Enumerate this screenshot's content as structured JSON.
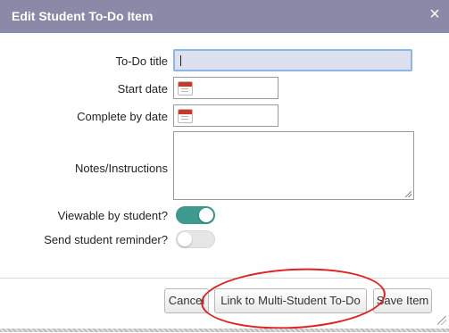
{
  "dialog": {
    "title": "Edit Student To-Do Item",
    "close_label": "×"
  },
  "form": {
    "todo_title": {
      "label": "To-Do title",
      "value": ""
    },
    "start_date": {
      "label": "Start date",
      "value": "",
      "icon": "calendar-icon"
    },
    "complete_by_date": {
      "label": "Complete by date",
      "value": "",
      "icon": "calendar-icon"
    },
    "notes": {
      "label": "Notes/Instructions",
      "value": ""
    },
    "viewable_by_student": {
      "label": "Viewable by student?",
      "on": true
    },
    "send_reminder": {
      "label": "Send student reminder?",
      "on": false
    }
  },
  "buttons": {
    "cancel": "Cancel",
    "link_multi": "Link to Multi-Student To-Do",
    "save": "Save Item"
  },
  "colors": {
    "titlebar": "#8a8aa8",
    "toggle_on": "#3e9a8c",
    "annotation": "#e02020"
  }
}
